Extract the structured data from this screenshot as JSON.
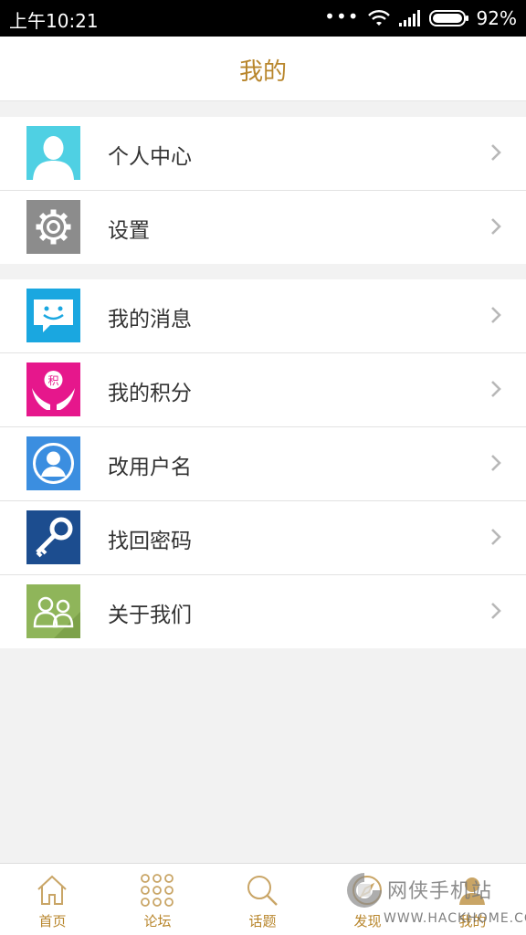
{
  "status_bar": {
    "time": "上午10:21",
    "battery": "92%",
    "icons": [
      "more-dots-icon",
      "wifi-icon",
      "signal-icon",
      "battery-icon"
    ]
  },
  "header": {
    "title": "我的"
  },
  "groups": [
    {
      "items": [
        {
          "label": "个人中心",
          "icon": "person-avatar-icon",
          "color": "#4fd0e3"
        },
        {
          "label": "设置",
          "icon": "gear-icon",
          "color": "#8c8c8c"
        }
      ]
    },
    {
      "items": [
        {
          "label": "我的消息",
          "icon": "chat-bubble-icon",
          "color": "#1aa7e0"
        },
        {
          "label": "我的积分",
          "icon": "points-hands-icon",
          "color": "#e6178c",
          "icon_text": "积"
        },
        {
          "label": "改用户名",
          "icon": "user-circle-icon",
          "color": "#3b8ee0"
        },
        {
          "label": "找回密码",
          "icon": "key-icon",
          "color": "#1c4d8f"
        },
        {
          "label": "关于我们",
          "icon": "people-icon",
          "color": "#8fb55a"
        }
      ]
    }
  ],
  "bottom_nav": [
    {
      "label": "首页",
      "icon": "home-icon"
    },
    {
      "label": "论坛",
      "icon": "grid-dots-icon"
    },
    {
      "label": "话题",
      "icon": "search-icon"
    },
    {
      "label": "发现",
      "icon": "discover-icon"
    },
    {
      "label": "我的",
      "icon": "user-icon"
    }
  ],
  "watermark": {
    "name": "网侠手机站",
    "url": "WWW.HACKHOME.COM"
  },
  "colors": {
    "accent": "#b8862c",
    "background": "#f2f2f2"
  }
}
